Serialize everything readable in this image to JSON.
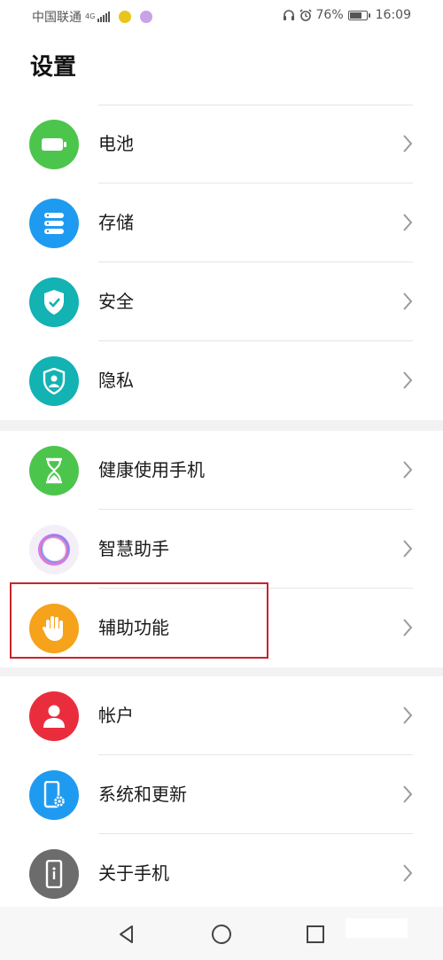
{
  "status_bar": {
    "carrier": "中国联通",
    "network": "4G",
    "battery_percent": "76%",
    "battery_level": 0.76,
    "time": "16:09"
  },
  "header": {
    "title": "设置"
  },
  "groups": [
    {
      "items": [
        {
          "label": "电池",
          "icon": "battery-icon",
          "color": "#4cc54c"
        },
        {
          "label": "存储",
          "icon": "storage-icon",
          "color": "#1e9bf0"
        },
        {
          "label": "安全",
          "icon": "shield-check-icon",
          "color": "#13b2b3"
        },
        {
          "label": "隐私",
          "icon": "privacy-icon",
          "color": "#13b2b3"
        }
      ]
    },
    {
      "items": [
        {
          "label": "健康使用手机",
          "icon": "hourglass-icon",
          "color": "#4cc54c"
        },
        {
          "label": "智慧助手",
          "icon": "assistant-ring-icon",
          "color": "#f3eef8"
        },
        {
          "label": "辅助功能",
          "icon": "hand-icon",
          "color": "#f6a21a"
        }
      ]
    },
    {
      "items": [
        {
          "label": "帐户",
          "icon": "account-icon",
          "color": "#ea2d3c"
        },
        {
          "label": "系统和更新",
          "icon": "phone-gear-icon",
          "color": "#1e9bf0"
        },
        {
          "label": "关于手机",
          "icon": "phone-info-icon",
          "color": "#6c6c6c"
        }
      ]
    }
  ],
  "highlighted_item": "辅助功能",
  "nav_bar": {
    "back": "back-icon",
    "home": "home-icon",
    "recents": "recents-icon"
  }
}
